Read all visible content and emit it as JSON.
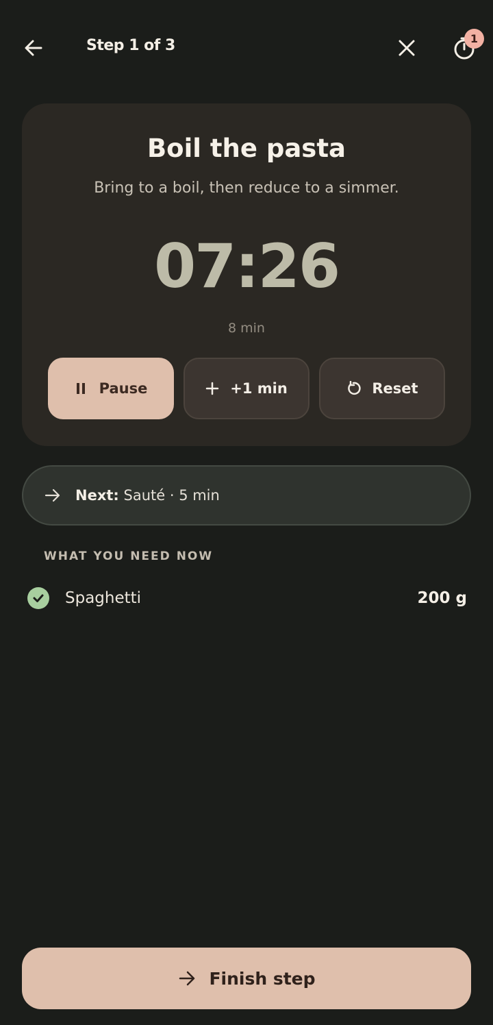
{
  "header": {
    "step_label": "Step 1 of 3",
    "timer_badge": "1",
    "icons": [
      "arrow-left-icon",
      "close-icon",
      "timer-icon"
    ]
  },
  "step": {
    "title": "Boil the pasta",
    "instruction": "Bring to a boil, then reduce to a simmer.",
    "remaining": "07:26",
    "duration": "8 min"
  },
  "controls": {
    "pause_label": "Pause",
    "add_label": "+1 min",
    "reset_label": "Reset"
  },
  "next": {
    "prefix": "Next:",
    "text": "Sauté · 5 min"
  },
  "needs": {
    "heading": "WHAT YOU NEED NOW",
    "items": [
      {
        "name": "Spaghetti",
        "quantity": "200 g",
        "checked": true
      }
    ]
  },
  "footer": {
    "finish_label": "Finish step"
  },
  "colors": {
    "background": "#1b1d1a",
    "accent": "#dfbfac",
    "badge": "#f2b1a3",
    "check": "#a8cf9f",
    "clock": "#bdbba8"
  }
}
